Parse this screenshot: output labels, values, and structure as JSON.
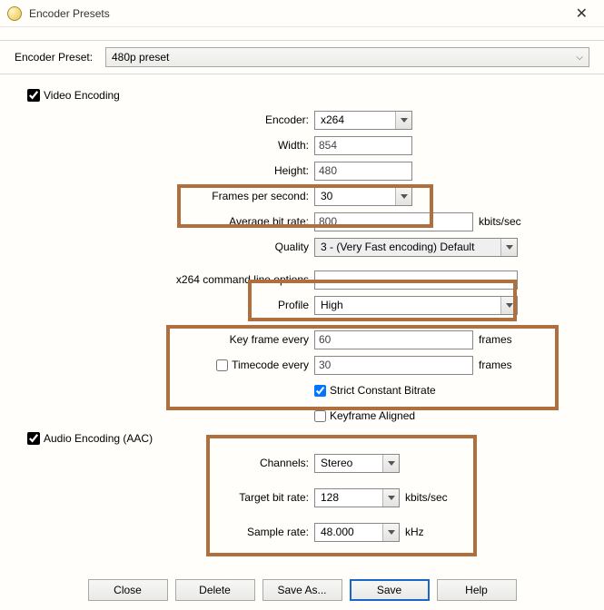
{
  "window": {
    "title": "Encoder Presets"
  },
  "presetRow": {
    "label": "Encoder Preset:",
    "value": "480p preset"
  },
  "video": {
    "sectionLabel": "Video Encoding",
    "encoder": {
      "label": "Encoder:",
      "value": "x264"
    },
    "width": {
      "label": "Width:",
      "value": "854"
    },
    "height": {
      "label": "Height:",
      "value": "480"
    },
    "fps": {
      "label": "Frames per second:",
      "value": "30"
    },
    "avgBitrate": {
      "label": "Average bit rate:",
      "value": "800",
      "unit": "kbits/sec"
    },
    "quality": {
      "label": "Quality",
      "value": "3 - (Very Fast encoding) Default"
    },
    "cmdOptions": {
      "label": "x264 command line options",
      "value": ""
    },
    "profile": {
      "label": "Profile",
      "value": "High"
    },
    "keyframe": {
      "label": "Key frame every",
      "value": "60",
      "unit": "frames"
    },
    "timecode": {
      "label": "Timecode every",
      "value": "30",
      "unit": "frames",
      "checked": false
    },
    "strictCBR": "Strict Constant Bitrate",
    "keyframeAligned": "Keyframe Aligned"
  },
  "audio": {
    "sectionLabel": "Audio Encoding (AAC)",
    "channels": {
      "label": "Channels:",
      "value": "Stereo"
    },
    "targetBitrate": {
      "label": "Target bit rate:",
      "value": "128",
      "unit": "kbits/sec"
    },
    "sampleRate": {
      "label": "Sample rate:",
      "value": "48.000",
      "unit": "kHz"
    }
  },
  "buttons": {
    "close": "Close",
    "delete": "Delete",
    "saveAs": "Save As...",
    "save": "Save",
    "help": "Help"
  }
}
